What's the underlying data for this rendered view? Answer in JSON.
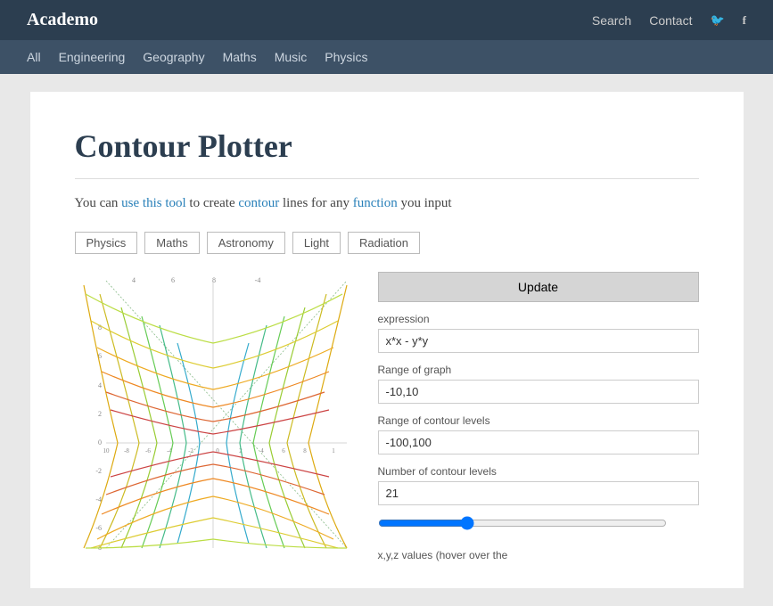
{
  "header": {
    "logo": "Academo",
    "nav": [
      {
        "label": "Search",
        "href": "#"
      },
      {
        "label": "Contact",
        "href": "#"
      },
      {
        "label": "🐦",
        "href": "#"
      },
      {
        "label": "f",
        "href": "#"
      }
    ]
  },
  "navbar": {
    "items": [
      {
        "label": "All",
        "href": "#"
      },
      {
        "label": "Engineering",
        "href": "#"
      },
      {
        "label": "Geography",
        "href": "#"
      },
      {
        "label": "Maths",
        "href": "#"
      },
      {
        "label": "Music",
        "href": "#"
      },
      {
        "label": "Physics",
        "href": "#"
      }
    ]
  },
  "page": {
    "title": "Contour Plotter",
    "description_parts": [
      {
        "text": "You can ",
        "type": "plain"
      },
      {
        "text": "use this tool",
        "type": "link"
      },
      {
        "text": " to create ",
        "type": "plain"
      },
      {
        "text": "contour",
        "type": "link"
      },
      {
        "text": " lines for any ",
        "type": "plain"
      },
      {
        "text": "function",
        "type": "link"
      },
      {
        "text": " you input",
        "type": "plain"
      }
    ],
    "description": "You can use this tool to create contour lines for any function you input"
  },
  "tags": [
    {
      "label": "Physics"
    },
    {
      "label": "Maths"
    },
    {
      "label": "Astronomy"
    },
    {
      "label": "Light"
    },
    {
      "label": "Radiation"
    }
  ],
  "controls": {
    "update_label": "Update",
    "expression_label": "expression",
    "expression_value": "x*x - y*y",
    "range_graph_label": "Range of graph",
    "range_graph_value": "-10,10",
    "range_contour_label": "Range of contour levels",
    "range_contour_value": "-100,100",
    "num_contour_label": "Number of contour levels",
    "num_contour_value": "21",
    "xyz_label": "x,y,z values (hover over the"
  }
}
